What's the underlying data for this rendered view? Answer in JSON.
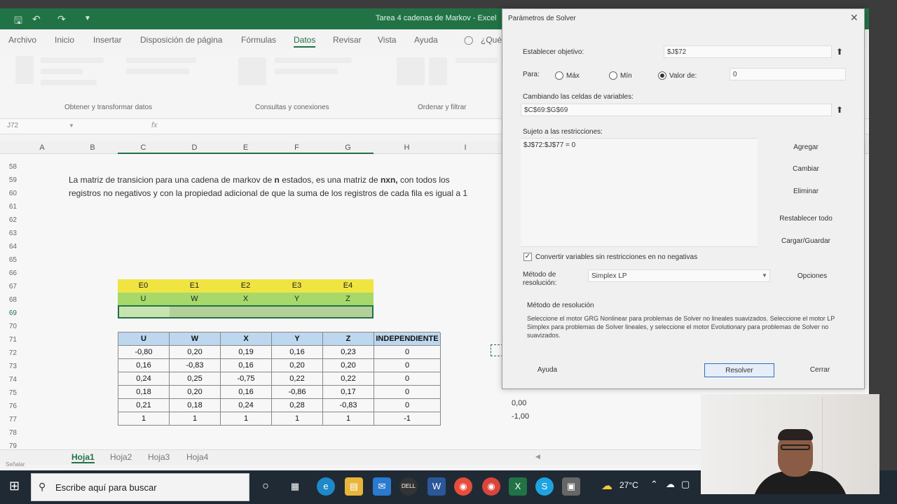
{
  "excel": {
    "window_title": "Tarea 4 cadenas de Markov  -  Excel",
    "ribbon_tabs": [
      "Archivo",
      "Inicio",
      "Insertar",
      "Disposición de página",
      "Fórmulas",
      "Datos",
      "Revisar",
      "Vista",
      "Ayuda",
      "¿Qué"
    ],
    "active_tab": "Datos",
    "ribbon_groups": [
      "Obtener y transformar datos",
      "Consultas y conexiones",
      "Ordenar y filtrar"
    ],
    "name_box": "J72",
    "fx_symbol": "fx",
    "columns": [
      "A",
      "B",
      "C",
      "D",
      "E",
      "F",
      "G",
      "H",
      "I"
    ],
    "rows": [
      "58",
      "59",
      "60",
      "61",
      "62",
      "63",
      "64",
      "65",
      "66",
      "67",
      "68",
      "69",
      "70",
      "71",
      "72",
      "73",
      "74",
      "75",
      "76",
      "77",
      "78",
      "79"
    ],
    "paragraph": {
      "line1_part1": "La matriz de transicion para una cadena de markov de ",
      "line1_bold1": "n",
      "line1_part2": " estados, es una matriz de ",
      "line1_bold2": "nxn,",
      "line1_part3": " con todos los",
      "line2": "registros no negativos y con la propiedad adicional de que la suma de los registros de cada fila es igual a 1"
    },
    "state_row": [
      "E0",
      "E1",
      "E2",
      "E3",
      "E4"
    ],
    "var_row": [
      "U",
      "W",
      "X",
      "Y",
      "Z"
    ],
    "table_headers": [
      "U",
      "W",
      "X",
      "Y",
      "Z",
      "INDEPENDIENTE"
    ],
    "table_rows": [
      [
        "-0,80",
        "0,20",
        "0,19",
        "0,16",
        "0,23",
        "0"
      ],
      [
        "0,16",
        "-0,83",
        "0,16",
        "0,20",
        "0,20",
        "0"
      ],
      [
        "0,24",
        "0,25",
        "-0,75",
        "0,22",
        "0,22",
        "0"
      ],
      [
        "0,18",
        "0,20",
        "0,16",
        "-0,86",
        "0,17",
        "0"
      ],
      [
        "0,21",
        "0,18",
        "0,24",
        "0,28",
        "-0,83",
        "0"
      ],
      [
        "1",
        "1",
        "1",
        "1",
        "1",
        "-1"
      ]
    ],
    "side_values": [
      "0,00",
      "-1,00"
    ],
    "sheet_tabs": [
      "Hoja1",
      "Hoja2",
      "Hoja3",
      "Hoja4"
    ],
    "active_sheet": "Hoja1",
    "status_text": "Señalar"
  },
  "solver": {
    "title": "Parámetros de Solver",
    "objective_label": "Establecer objetivo:",
    "objective_value": "$J$72",
    "to_label": "Para:",
    "opt_max": "Máx",
    "opt_min": "Mín",
    "opt_value": "Valor de:",
    "value_of": "0",
    "selected_option": "Valor de:",
    "changing_label": "Cambiando las celdas de variables:",
    "changing_value": "$C$69:$G$69",
    "constraints_label": "Sujeto a las restricciones:",
    "constraints": [
      "$J$72:$J$77 = 0"
    ],
    "btn_add": "Agregar",
    "btn_change": "Cambiar",
    "btn_delete": "Eliminar",
    "btn_reset": "Restablecer todo",
    "btn_load": "Cargar/Guardar",
    "nonneg_label": "Convertir variables sin restricciones en no negativas",
    "nonneg_checked": true,
    "method_label_1": "Método de",
    "method_label_2": "resolución:",
    "method_value": "Simplex LP",
    "btn_options": "Opciones",
    "method_heading": "Método de resolución",
    "method_desc": "Seleccione el motor GRG Nonlinear para problemas de Solver no lineales suavizados. Seleccione el motor LP Simplex para problemas de Solver lineales, y seleccione el motor Evolutionary para problemas de Solver no suavizados.",
    "btn_help": "Ayuda",
    "btn_solve": "Resolver",
    "btn_close": "Cerrar"
  },
  "taskbar": {
    "search_placeholder": "Escribe aquí para buscar",
    "temperature": "27°C"
  },
  "colors": {
    "excel_green": "#217346",
    "yellow": "#f0e442",
    "green_light": "#a6d96a",
    "table_header_blue": "#bdd7ee"
  }
}
